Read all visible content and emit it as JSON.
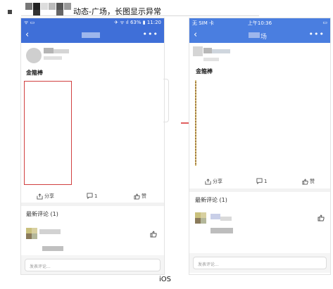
{
  "heading": "动态-广场，长图显示异常",
  "caption": "iOS",
  "left_phone": {
    "status_time": "11:20",
    "battery": "63%",
    "post_title": "金箍棒",
    "share_label": "分享",
    "comment_count": "1",
    "like_label": "赞",
    "comments_header": "最新评论 (1)",
    "comment_placeholder": "发表评论..."
  },
  "right_phone": {
    "carrier": "无 SIM 卡",
    "status_time": "上午10:36",
    "nav_title_suffix": "场",
    "post_title": "金箍棒",
    "share_label": "分享",
    "comment_count": "1",
    "like_label": "赞",
    "comments_header": "最新评论 (1)",
    "comment_placeholder": "发表评论..."
  },
  "colors": {
    "nav_blue": "#3f6fd8",
    "arrow_red": "#d62a2a",
    "box_red": "#d14040"
  },
  "icons": [
    "back-chevron-icon",
    "more-dots-icon",
    "share-icon",
    "comment-icon",
    "thumb-up-icon",
    "red-arrow-icon"
  ]
}
